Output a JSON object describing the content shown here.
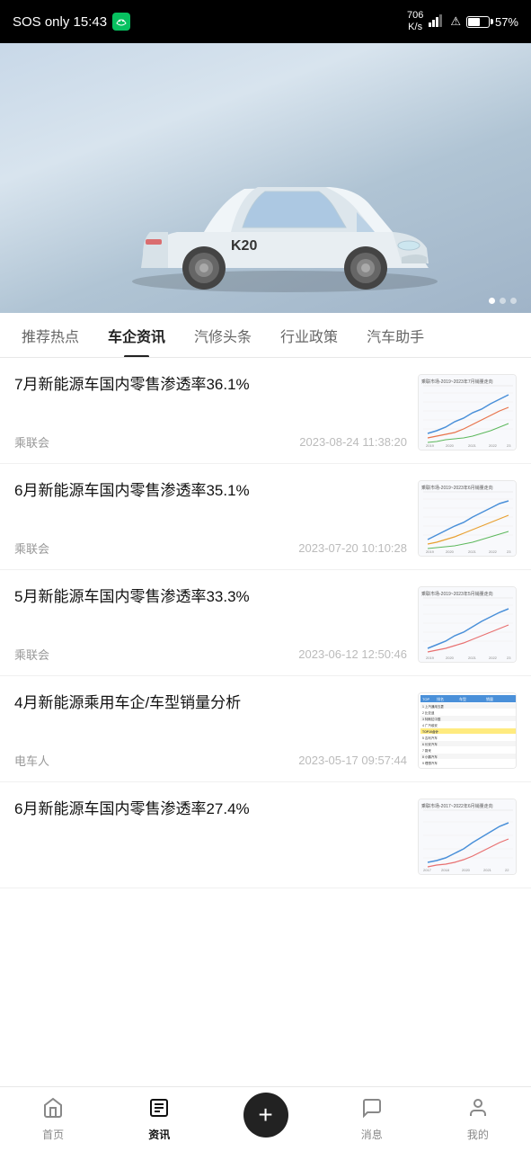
{
  "statusBar": {
    "left": "SOS only  15:43",
    "wechatLabel": "W",
    "network": "706\nK/s",
    "wifi": "WiFi",
    "battery": "57%"
  },
  "heroCar": {
    "model": "K20",
    "dots": [
      true,
      false,
      false
    ]
  },
  "navTabs": [
    {
      "id": "hot",
      "label": "推荐热点",
      "active": false
    },
    {
      "id": "car-news",
      "label": "车企资讯",
      "active": true
    },
    {
      "id": "repair",
      "label": "汽修头条",
      "active": false
    },
    {
      "id": "policy",
      "label": "行业政策",
      "active": false
    },
    {
      "id": "assistant",
      "label": "汽车助手",
      "active": false
    }
  ],
  "newsItems": [
    {
      "id": "news1",
      "title": "7月新能源车国内零售渗透率36.1%",
      "source": "乘联会",
      "time": "2023-08-24 11:38:20",
      "chartType": "line-chart-1"
    },
    {
      "id": "news2",
      "title": "6月新能源车国内零售渗透率35.1%",
      "source": "乘联会",
      "time": "2023-07-20 10:10:28",
      "chartType": "line-chart-2"
    },
    {
      "id": "news3",
      "title": "5月新能源车国内零售渗透率33.3%",
      "source": "乘联会",
      "time": "2023-06-12 12:50:46",
      "chartType": "line-chart-3"
    },
    {
      "id": "news4",
      "title": "4月新能源乘用车企/车型销量分析",
      "source": "电车人",
      "time": "2023-05-17 09:57:44",
      "chartType": "table-chart"
    },
    {
      "id": "news5",
      "title": "6月新能源车国内零售渗透率27.4%",
      "source": "",
      "time": "",
      "chartType": "line-chart-4"
    }
  ],
  "bottomNav": [
    {
      "id": "home",
      "label": "首页",
      "icon": "🏠",
      "active": false
    },
    {
      "id": "news",
      "label": "资讯",
      "icon": "📰",
      "active": true
    },
    {
      "id": "add",
      "label": "+",
      "icon": "+",
      "active": false,
      "isAdd": true
    },
    {
      "id": "messages",
      "label": "消息",
      "icon": "💬",
      "active": false
    },
    {
      "id": "profile",
      "label": "我的",
      "icon": "👤",
      "active": false
    }
  ]
}
